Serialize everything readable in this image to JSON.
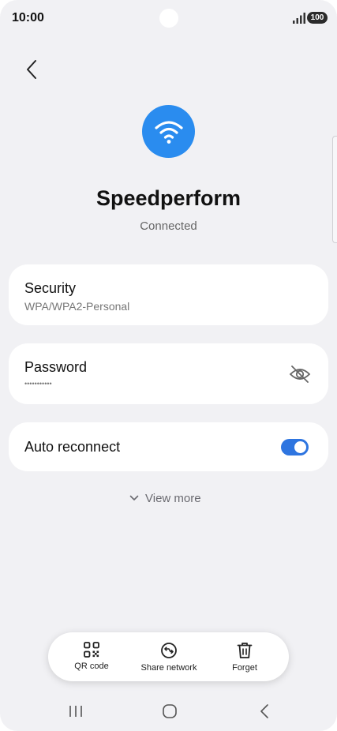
{
  "status_bar": {
    "time": "10:00",
    "battery": "100",
    "signal_icon": "signal-bars-icon"
  },
  "header": {
    "back_icon": "chevron-left-icon"
  },
  "network": {
    "icon": "wifi-icon",
    "accent_color": "#2a8cef",
    "name": "Speedperform",
    "status": "Connected"
  },
  "security": {
    "label": "Security",
    "value": "WPA/WPA2-Personal"
  },
  "password": {
    "label": "Password",
    "value": "•••••••••••",
    "toggle_icon": "eye-off-icon"
  },
  "auto_reconnect": {
    "label": "Auto reconnect",
    "enabled": true,
    "toggle_color": "#2e75e0"
  },
  "view_more": {
    "label": "View more",
    "icon": "chevron-down-icon"
  },
  "actions": [
    {
      "label": "QR code",
      "icon": "qr-code-icon"
    },
    {
      "label": "Share network",
      "icon": "share-network-icon"
    },
    {
      "label": "Forget",
      "icon": "trash-icon"
    }
  ],
  "nav_bar": {
    "recents_icon": "recents-icon",
    "home_icon": "home-icon",
    "back_icon": "back-icon"
  }
}
